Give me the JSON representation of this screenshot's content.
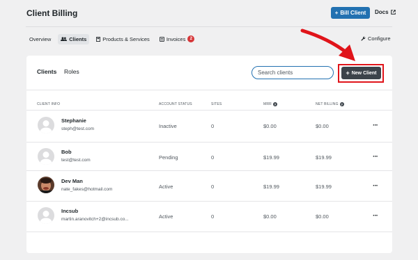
{
  "header": {
    "title": "Client Billing",
    "bill_client_label": "Bill Client",
    "docs_label": "Docs"
  },
  "nav": {
    "tabs": [
      {
        "label": "Overview"
      },
      {
        "label": "Clients"
      },
      {
        "label": "Products & Services"
      },
      {
        "label": "Invoices",
        "badge": "2"
      }
    ],
    "configure_label": "Configure"
  },
  "card": {
    "tabs": [
      {
        "label": "Clients"
      },
      {
        "label": "Roles"
      }
    ],
    "search_placeholder": "Search clients",
    "new_client_label": "New Client"
  },
  "table": {
    "columns": [
      "Client Info",
      "Account Status",
      "Sites",
      "MRR",
      "Net Billing"
    ],
    "rows": [
      {
        "name": "Stephanie",
        "email": "steph@test.com",
        "status": "Inactive",
        "sites": "0",
        "mrr": "$0.00",
        "net": "$0.00",
        "avatar": "default"
      },
      {
        "name": "Bob",
        "email": "test@test.com",
        "status": "Pending",
        "sites": "0",
        "mrr": "$19.99",
        "net": "$19.99",
        "avatar": "default"
      },
      {
        "name": "Dev Man",
        "email": "nate_fakes@hotmail.com",
        "status": "Active",
        "sites": "0",
        "mrr": "$19.99",
        "net": "$19.99",
        "avatar": "photo"
      },
      {
        "name": "Incsub",
        "email": "martin.aranovitch+2@incsub.co...",
        "status": "Active",
        "sites": "0",
        "mrr": "$0.00",
        "net": "$0.00",
        "avatar": "default"
      }
    ]
  },
  "colors": {
    "primary": "#2271b1",
    "dark_button": "#3c434a",
    "highlight": "#e0141a",
    "badge": "#d63638"
  }
}
